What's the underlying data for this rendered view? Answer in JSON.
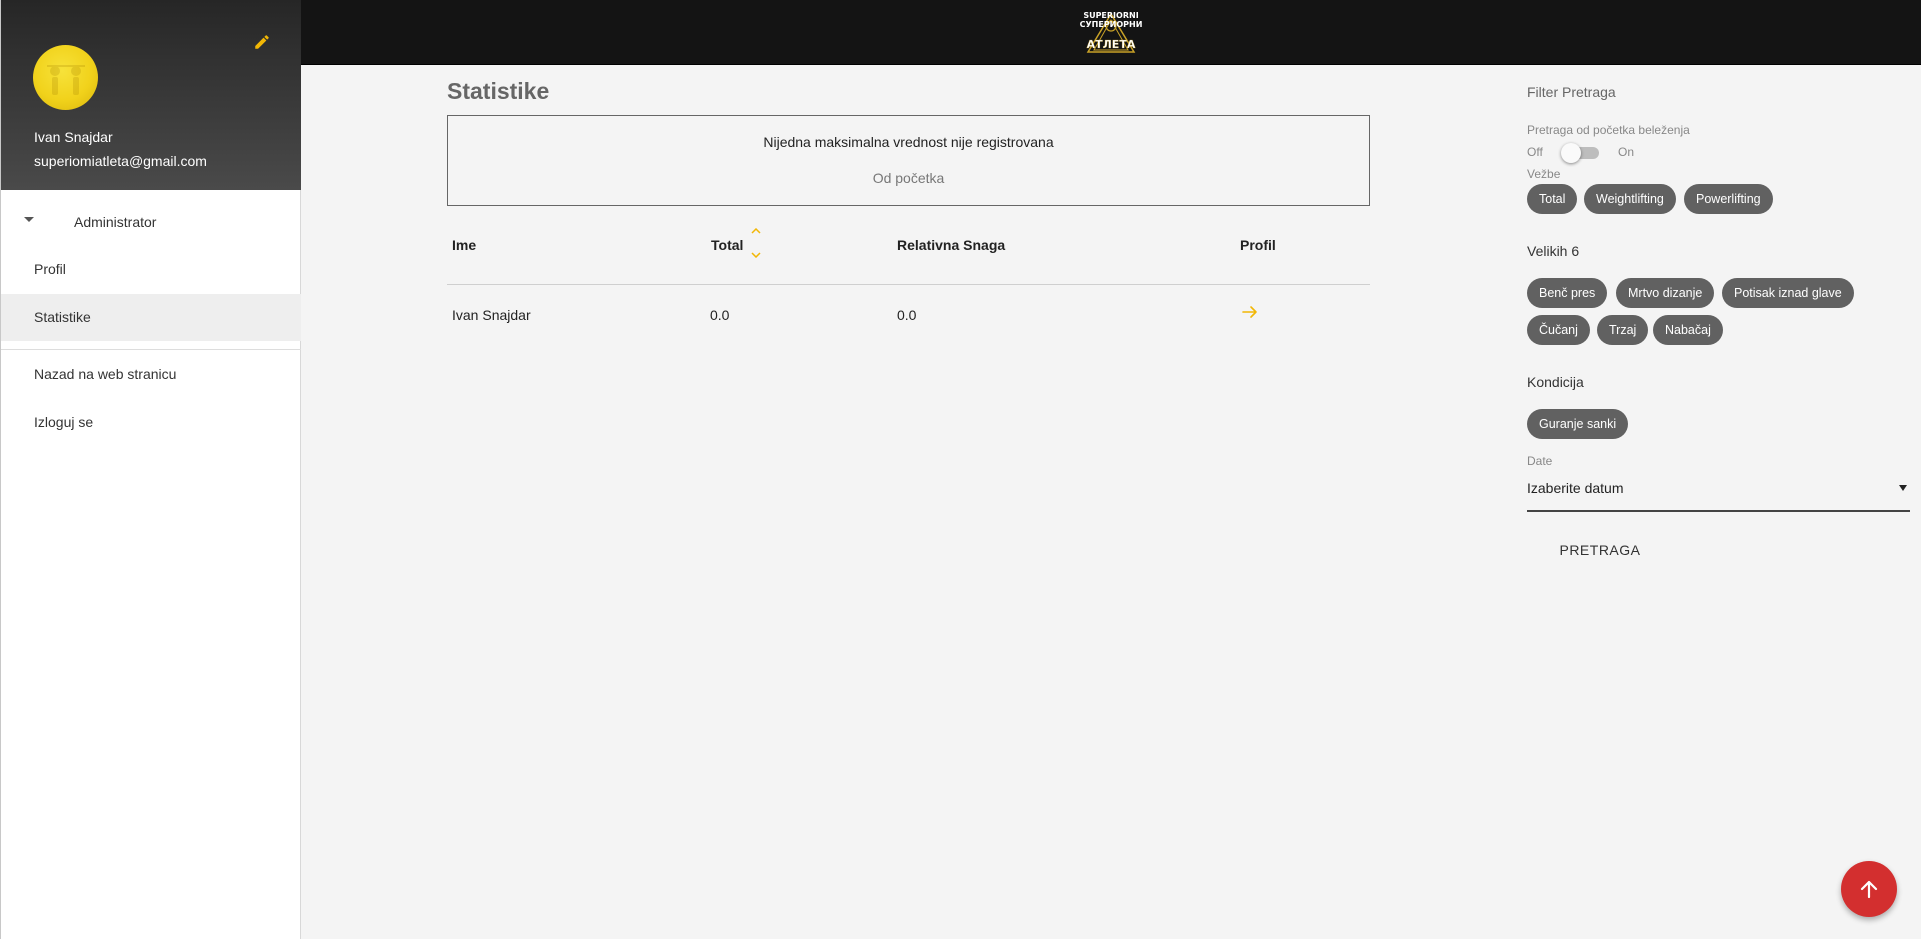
{
  "sidebar": {
    "user_name": "Ivan Snajdar",
    "user_email": "superiomiatleta@gmail.com",
    "group_label": "Administrator",
    "items": [
      {
        "label": "Profil"
      },
      {
        "label": "Statistike"
      },
      {
        "label": "Nazad na web stranicu"
      },
      {
        "label": "Izloguj se"
      }
    ],
    "active_item": "Statistike"
  },
  "topbar": {
    "logo_text_top": "SUPERIORNI",
    "logo_text_mid": "СУПЕРИОРНИ",
    "logo_text_bottom": "АТЛЕТА"
  },
  "main": {
    "title": "Statistike",
    "info_message": "Nijedna maksimalna vrednost nije registrovana",
    "info_sub": "Od početka",
    "table": {
      "headers": [
        "Ime",
        "Total",
        "Relativna Snaga",
        "Profil"
      ],
      "rows": [
        {
          "name": "Ivan Snajdar",
          "total": "0.0",
          "relative": "0.0"
        }
      ]
    }
  },
  "filter": {
    "title": "Filter Pretraga",
    "from_start_label": "Pretraga od početka beleženja",
    "toggle_off": "Off",
    "toggle_on": "On",
    "toggle_state": "off",
    "exercises_label": "Vežbe",
    "exercise_chips": [
      "Total",
      "Weightlifting",
      "Powerlifting"
    ],
    "big6_title": "Velikih 6",
    "big6_chips": [
      "Benč pres",
      "Mrtvo dizanje",
      "Potisak iznad glave",
      "Čučanj",
      "Trzaj",
      "Nabačaj"
    ],
    "kondicija_title": "Kondicija",
    "kondicija_chips": [
      "Guranje sanki"
    ],
    "date_label": "Date",
    "date_placeholder": "Izaberite datum",
    "search_label": "PRETRAGA"
  },
  "colors": {
    "accent": "#f2b705",
    "chip": "#616161",
    "fab": "#d32f2f",
    "topbar": "#141414"
  }
}
